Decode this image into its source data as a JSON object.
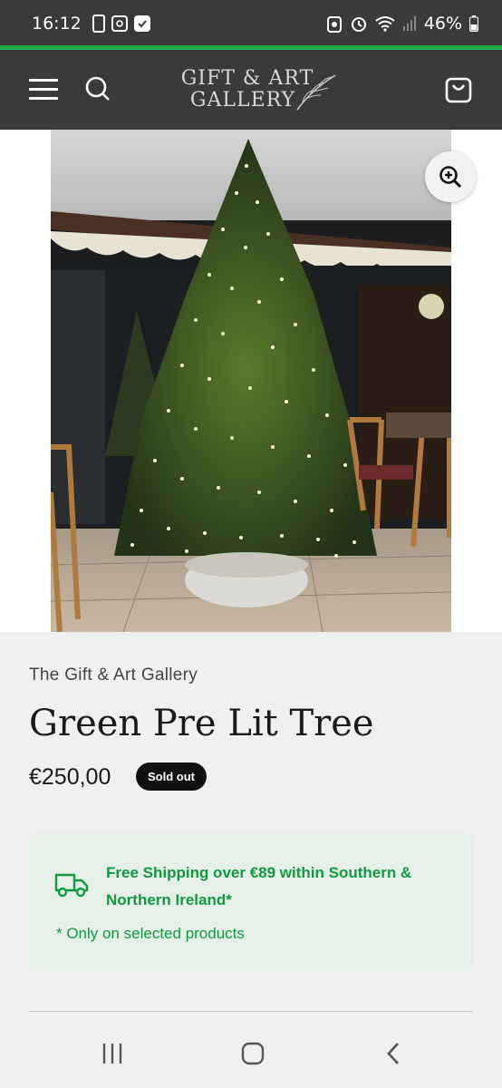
{
  "status_bar": {
    "time": "16:12",
    "battery": "46%"
  },
  "header": {
    "logo_line1": "GIFT & ART",
    "logo_line2": "GALLERY"
  },
  "product": {
    "vendor": "The Gift & Art Gallery",
    "title": "Green Pre Lit Tree",
    "price": "€250,00",
    "badge": "Sold out"
  },
  "shipping": {
    "text": "Free Shipping over €89 within Southern & Northern Ireland*",
    "note": "* Only on selected products"
  },
  "colors": {
    "header_bg": "#3a3a3a",
    "accent": "#1fa84a",
    "shipping_text": "#0f9a3f",
    "shipping_bg": "#e6f0e9"
  }
}
